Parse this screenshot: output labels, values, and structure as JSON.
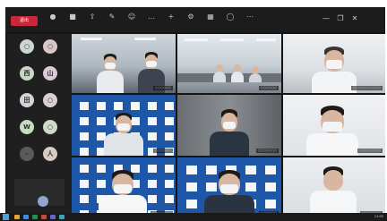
{
  "toolbar": {
    "end_label": "退出",
    "tools": [
      {
        "icon": "mic-icon",
        "glyph": "●",
        "label": ""
      },
      {
        "icon": "video-icon",
        "glyph": "■",
        "label": ""
      },
      {
        "icon": "share-icon",
        "glyph": "⇧",
        "label": ""
      },
      {
        "icon": "chat-icon",
        "glyph": "✎",
        "label": ""
      },
      {
        "icon": "participants-icon",
        "glyph": "☺",
        "label": ""
      },
      {
        "icon": "more-icon",
        "glyph": "…",
        "label": ""
      },
      {
        "icon": "add-icon",
        "glyph": "+",
        "label": ""
      },
      {
        "icon": "settings-icon",
        "glyph": "⚙",
        "label": ""
      },
      {
        "icon": "layout-icon",
        "glyph": "▦",
        "label": ""
      },
      {
        "icon": "record-icon",
        "glyph": "◯",
        "label": ""
      },
      {
        "icon": "options-icon",
        "glyph": "⋯",
        "label": ""
      }
    ],
    "minimize": "—",
    "restore": "❐",
    "close": "✕"
  },
  "participants": [
    {
      "initial": "○",
      "color": "#cdd5d1"
    },
    {
      "initial": "○",
      "color": "#d7c7c6"
    },
    {
      "initial": "西",
      "color": "#c9d8c5"
    },
    {
      "initial": "山",
      "color": "#d9cbd6"
    },
    {
      "initial": "田",
      "color": "#d2d4dc"
    },
    {
      "initial": "○",
      "color": "#d8d0d0"
    },
    {
      "initial": "W",
      "color": "#c8dcc3"
    },
    {
      "initial": "○",
      "color": "#cfd8c9"
    },
    {
      "initial": "–",
      "color": "#5a5a5a"
    },
    {
      "initial": "人",
      "color": "#d6cbc4"
    }
  ],
  "videos": [
    {
      "name": "○○○○○○"
    },
    {
      "name": "○○○○○○"
    },
    {
      "name": "○○○○○○○○○○"
    },
    {
      "name": "○○○○○○"
    },
    {
      "name": "○○○○○○○"
    },
    {
      "name": "○○○○○○○○"
    },
    {
      "name": "○○○○○○○"
    },
    {
      "name": "○○○○○○"
    },
    {
      "name": "○○○○○○○"
    }
  ],
  "taskbar": {
    "clock": "11:05"
  }
}
